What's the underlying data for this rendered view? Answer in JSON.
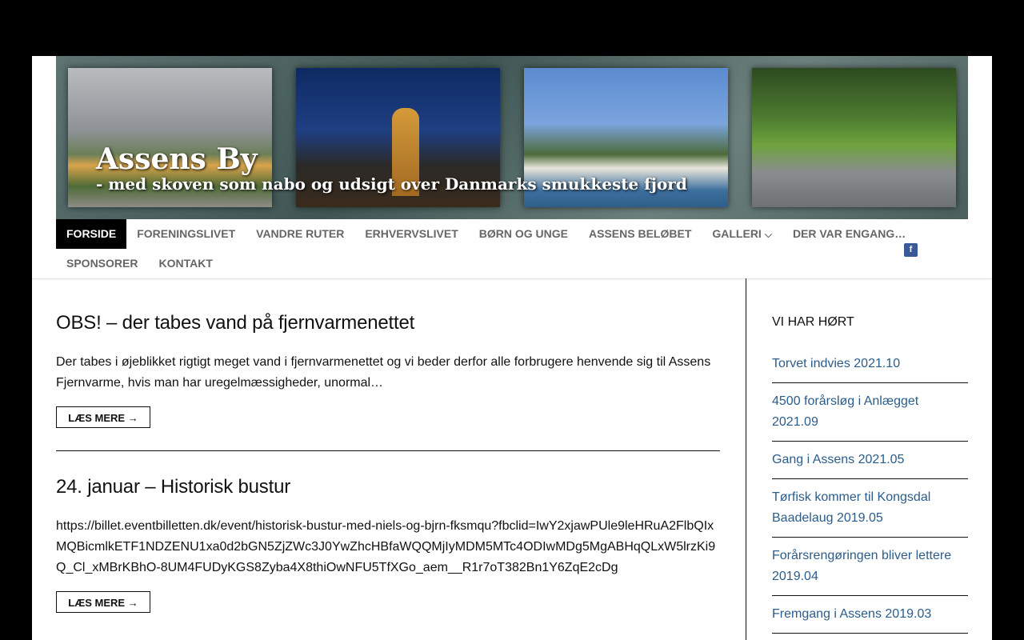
{
  "header": {
    "title": "Assens By",
    "subtitle": "- med skoven som nabo og udsigt over Danmarks smukkeste fjord"
  },
  "nav": {
    "row1": [
      {
        "label": "FORSIDE",
        "active": true
      },
      {
        "label": "FORENINGSLIVET"
      },
      {
        "label": "VANDRE RUTER"
      },
      {
        "label": "ERHVERVSLIVET"
      },
      {
        "label": "BØRN OG UNGE"
      },
      {
        "label": "ASSENS BELØBET"
      },
      {
        "label": "GALLERI",
        "dropdown": true
      },
      {
        "label": "DER VAR ENGANG…"
      }
    ],
    "row2": [
      {
        "label": "SPONSORER"
      },
      {
        "label": "KONTAKT"
      }
    ],
    "social_icon": "facebook-icon",
    "social_glyph": "f"
  },
  "posts": [
    {
      "title": "OBS! – der tabes vand på fjernvarmenettet",
      "excerpt": "Der tabes i øjeblikket rigtigt meget vand i fjernvarmenettet og vi beder derfor alle forbrugere henvende sig til Assens Fjernvarme, hvis man har uregelmæssigheder, unormal…",
      "read_more": "LÆS MERE →"
    },
    {
      "title": "24. januar – Historisk bustur",
      "excerpt": "https://billet.eventbilletten.dk/event/historisk-bustur-med-niels-og-bjrn-fksmqu?fbclid=IwY2xjawPUle9leHRuA2FlbQIxMQBicmlkETF1NDZENU1xa0d2bGN5ZjZWc3J0YwZhcHBfaWQQMjIyMDM5MTc4ODIwMDg5MgABHqQLxW5lrzKi9Q_Cl_xMBrKBhO-8UM4FUDyKGS8Zyba4X8thiOwNFU5TfXGo_aem__R1r7oT382Bn1Y6ZqE2cDg",
      "read_more": "LÆS MERE →"
    }
  ],
  "sidebar": {
    "heading": "VI HAR HØRT",
    "links": [
      "Torvet indvies 2021.10",
      "4500 forårsløg i Anlægget 2021.09",
      "Gang i Assens 2021.05",
      "Tørfisk kommer til Kongsdal Baadelaug 2019.05",
      "Forårsrengøringen bliver lettere 2019.04",
      "Fremgang i Assens 2019.03"
    ]
  },
  "colors": {
    "nav_active_bg": "#000000",
    "link": "#2b5c8a",
    "facebook": "#3b5998"
  }
}
